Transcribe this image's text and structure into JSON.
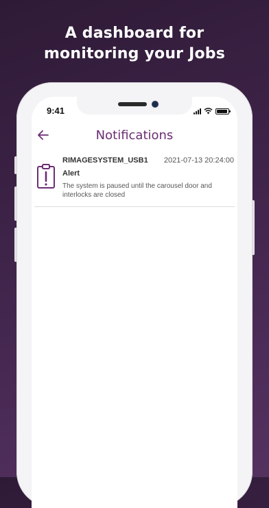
{
  "headline": {
    "line1": "A dashboard for",
    "line2": "monitoring your Jobs"
  },
  "status_bar": {
    "time": "9:41"
  },
  "app_bar": {
    "title": "Notifications",
    "back_icon": "arrow-left-icon"
  },
  "notifications": [
    {
      "icon": "clipboard-alert-icon",
      "source": "RIMAGESYSTEM_USB1",
      "timestamp": "2021-07-13 20:24:00",
      "type": "Alert",
      "message": "The system is paused until the carousel door and interlocks are closed"
    }
  ],
  "colors": {
    "accent": "#6b2d73",
    "background": "#3d2347",
    "screen": "#ffffff"
  }
}
